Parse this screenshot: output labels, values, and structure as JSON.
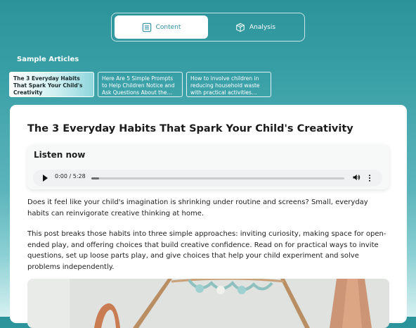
{
  "tabs": [
    {
      "label": "Content",
      "icon": "document-icon",
      "active": true
    },
    {
      "label": "Analysis",
      "icon": "cube-icon",
      "active": false
    }
  ],
  "sidebar": {
    "section_title": "Sample Articles",
    "articles": [
      {
        "label": "The 3 Everyday Habits That Spark Your Child's Creativity",
        "active": true
      },
      {
        "label": "Here Are 5 Simple Prompts to Help Children Notice and Ask Questions About the Natural...",
        "active": false
      },
      {
        "label": "How to involve children in reducing household waste with practical activities and...",
        "active": false
      }
    ]
  },
  "article": {
    "title": "The 3 Everyday Habits That Spark Your Child's Creativity",
    "listen_title": "Listen now",
    "player": {
      "time": "0:00 / 5:28",
      "progress": 0.03
    },
    "paragraphs": [
      "Does it feel like your child's imagination is shrinking under routine and screens? Small, everyday habits can reinvigorate creative thinking at home.",
      "This post breaks those habits into three simple approaches: inviting curiosity, making space for open-ended play, and offering choices that build creative confidence. Read on for practical ways to invite questions, set up loose parts play, and give choices that help your child experiment and solve problems independently."
    ]
  },
  "colors": {
    "accent": "#2f8fa0",
    "background_top": "#2b939a"
  }
}
